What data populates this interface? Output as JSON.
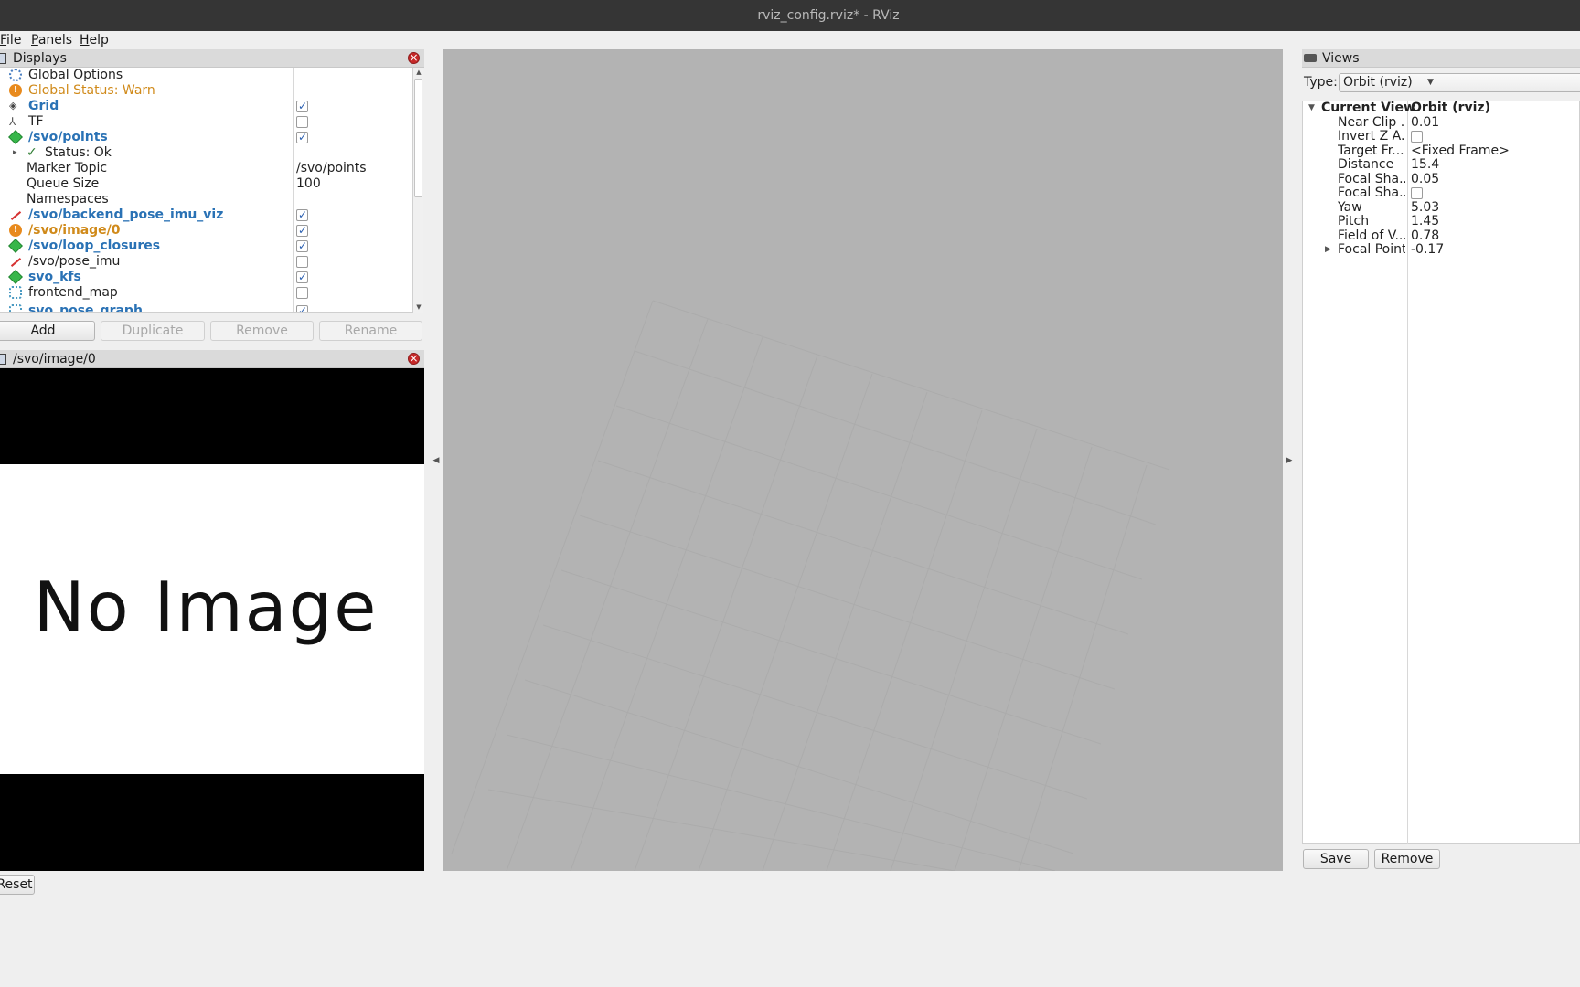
{
  "window": {
    "title": "rviz_config.rviz* - RViz"
  },
  "menu": {
    "items": [
      "File",
      "Panels",
      "Help"
    ]
  },
  "displays_panel": {
    "title": "Displays",
    "rows": [
      {
        "label": "Global Options",
        "icon": "gear-icon",
        "style": "normal"
      },
      {
        "label": "Global Status: Warn",
        "icon": "warning-icon",
        "style": "warn"
      },
      {
        "label": "Grid",
        "icon": "grid-icon",
        "style": "bold-blue",
        "checked": true
      },
      {
        "label": "TF",
        "icon": "tf-icon",
        "style": "normal",
        "checked": false
      },
      {
        "label": "/svo/points",
        "icon": "marker-cube-icon",
        "style": "bold-blue",
        "checked": true
      },
      {
        "label": "Status: Ok",
        "icon": "checkmark-icon",
        "style": "normal"
      },
      {
        "label": "Marker Topic",
        "value": "/svo/points"
      },
      {
        "label": "Queue Size",
        "value": "100"
      },
      {
        "label": "Namespaces",
        "value": ""
      },
      {
        "label": "/svo/backend_pose_imu_viz",
        "icon": "arrow-icon",
        "style": "bold-blue",
        "checked": true
      },
      {
        "label": "/svo/image/0",
        "icon": "warning-icon",
        "style": "bold-warn",
        "checked": true
      },
      {
        "label": "/svo/loop_closures",
        "icon": "marker-cube-icon",
        "style": "bold-blue",
        "checked": true
      },
      {
        "label": "/svo/pose_imu",
        "icon": "pose-arrow-icon",
        "style": "normal",
        "checked": false
      },
      {
        "label": "svo_kfs",
        "icon": "marker-cube-icon",
        "style": "bold-blue",
        "checked": true
      },
      {
        "label": "frontend_map",
        "icon": "pointcloud-icon",
        "style": "normal",
        "checked": false
      },
      {
        "label": "svo_pose_graph",
        "icon": "pointcloud-icon",
        "style": "bold-blue",
        "checked": true
      }
    ],
    "buttons": {
      "add": "Add",
      "duplicate": "Duplicate",
      "remove": "Remove",
      "rename": "Rename"
    }
  },
  "image_panel": {
    "title": "/svo/image/0",
    "placeholder": "No Image"
  },
  "views_panel": {
    "title": "Views",
    "type_label": "Type:",
    "type_value": "Orbit (rviz)",
    "current_view": {
      "label": "Current View",
      "value": "Orbit (rviz)"
    },
    "properties": [
      {
        "name": "Near Clip ...",
        "value": "0.01"
      },
      {
        "name": "Invert Z A...",
        "checkbox": true
      },
      {
        "name": "Target Fr...",
        "value": "<Fixed Frame>"
      },
      {
        "name": "Distance",
        "value": "15.4"
      },
      {
        "name": "Focal Sha...",
        "value": "0.05"
      },
      {
        "name": "Focal Sha...",
        "checkbox": true
      },
      {
        "name": "Yaw",
        "value": "5.03"
      },
      {
        "name": "Pitch",
        "value": "1.45"
      },
      {
        "name": "Field of V...",
        "value": "0.78"
      },
      {
        "name": "Focal Point",
        "value": "-0.17"
      }
    ],
    "buttons": {
      "save": "Save",
      "remove": "Remove"
    }
  },
  "statusbar": {
    "reset": "Reset"
  },
  "colors": {
    "accent_blue": "#2a72b5",
    "warn_orange": "#d08a1a",
    "render_bg": "#b3b3b3",
    "titlebar": "#353535"
  }
}
